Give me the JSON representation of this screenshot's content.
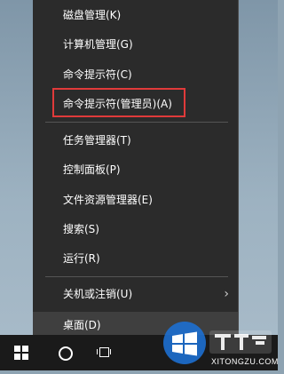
{
  "menu": {
    "items": [
      {
        "label": "磁盘管理(K)"
      },
      {
        "label": "计算机管理(G)"
      },
      {
        "label": "命令提示符(C)"
      },
      {
        "label": "命令提示符(管理员)(A)"
      },
      {
        "label": "任务管理器(T)"
      },
      {
        "label": "控制面板(P)"
      },
      {
        "label": "文件资源管理器(E)"
      },
      {
        "label": "搜索(S)"
      },
      {
        "label": "运行(R)"
      },
      {
        "label": "关机或注销(U)",
        "submenu_indicator": "›"
      },
      {
        "label": "桌面(D)"
      }
    ]
  },
  "taskbar": {
    "start_icon": "windows-logo-icon",
    "search_icon": "cortana-circle-icon",
    "taskview_icon": "task-view-icon"
  },
  "watermark": {
    "text": "XITONGZU.COM"
  },
  "colors": {
    "menu_bg": "#2b2b2b",
    "highlight_border": "#e03a3a",
    "taskbar_bg": "#1a1a1a"
  }
}
